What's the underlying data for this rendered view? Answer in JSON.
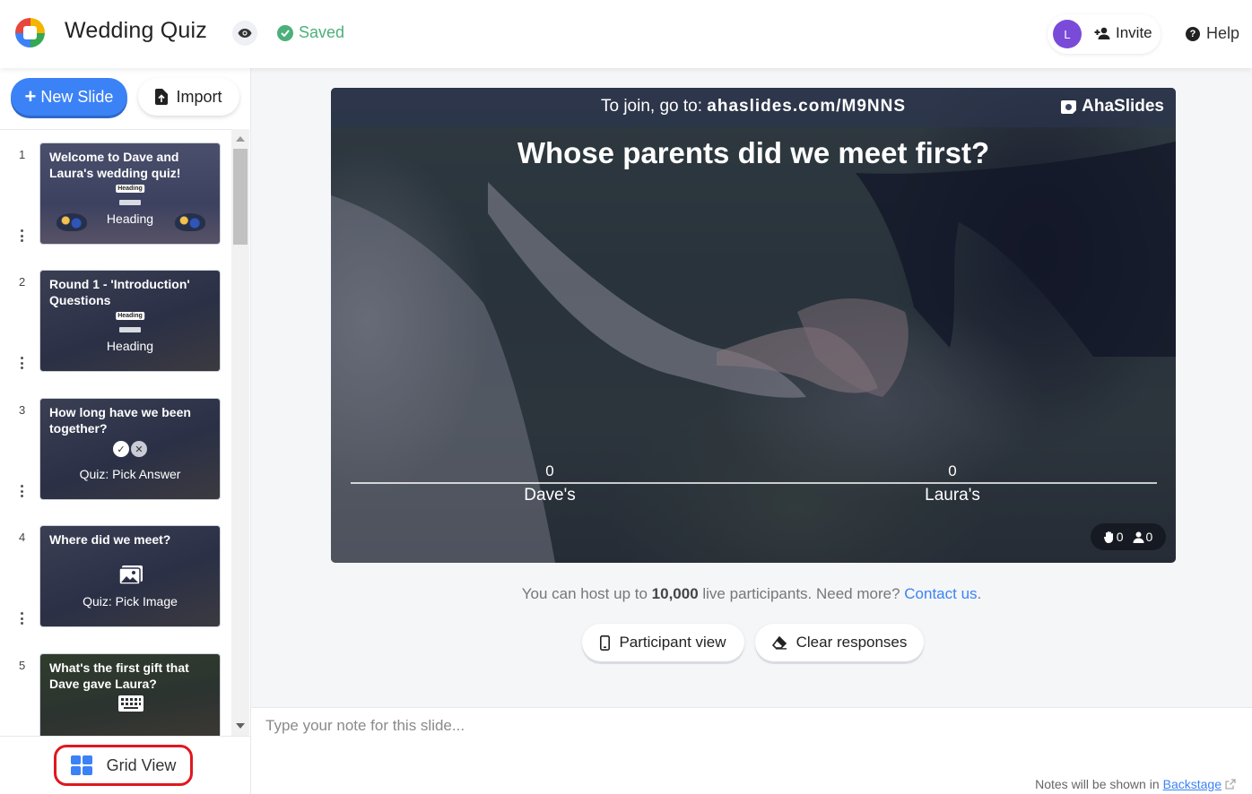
{
  "header": {
    "title": "Wedding Quiz",
    "saved_label": "Saved",
    "avatar_initial": "L",
    "invite_label": "Invite",
    "help_label": "Help"
  },
  "sidebar": {
    "new_slide_label": "New Slide",
    "import_label": "Import",
    "grid_view_label": "Grid View",
    "slides": [
      {
        "number": "1",
        "title": "Welcome to Dave and Laura's wedding quiz!",
        "tag": "Heading",
        "type": "Heading"
      },
      {
        "number": "2",
        "title": "Round 1 - 'Introduction' Questions",
        "tag": "Heading",
        "type": "Heading"
      },
      {
        "number": "3",
        "title": "How long have we been together?",
        "type": "Quiz: Pick Answer"
      },
      {
        "number": "4",
        "title": "Where did we meet?",
        "type": "Quiz: Pick Image"
      },
      {
        "number": "5",
        "title": "What's the first gift that Dave gave Laura?",
        "type": "Quiz: Type Answer"
      }
    ]
  },
  "slide": {
    "join_prefix": "To join, go to: ",
    "join_url": "ahaslides.com/M9NNS",
    "brand": "AhaSlides",
    "question": "Whose parents did we meet first?",
    "options": [
      {
        "label": "Dave's",
        "count": "0"
      },
      {
        "label": "Laura's",
        "count": "0"
      }
    ],
    "reactions_count": "0",
    "participants_count": "0"
  },
  "chart_data": {
    "type": "bar",
    "categories": [
      "Dave's",
      "Laura's"
    ],
    "values": [
      0,
      0
    ]
  },
  "host_note": {
    "prefix": "You can host up to ",
    "number": "10,000",
    "middle": " live participants. Need more? ",
    "link": "Contact us",
    "suffix": "."
  },
  "actions": {
    "participant_view_label": "Participant view",
    "clear_responses_label": "Clear responses"
  },
  "notes": {
    "placeholder": "Type your note for this slide...",
    "footer_prefix": "Notes will be shown in ",
    "footer_link": "Backstage"
  },
  "colors": {
    "accent": "#3b82f6",
    "saved": "#4cb07a",
    "avatar": "#7a4bd8",
    "highlight_box": "#e0171f"
  },
  "icons": [
    "app-logo-icon",
    "eye-icon",
    "check-circle-icon",
    "add-user-icon",
    "help-circle-icon",
    "plus-icon",
    "file-import-icon",
    "grid-icon",
    "ahaslides-logo-icon",
    "hand-icon",
    "user-icon",
    "phone-icon",
    "eraser-icon",
    "external-link-icon"
  ]
}
